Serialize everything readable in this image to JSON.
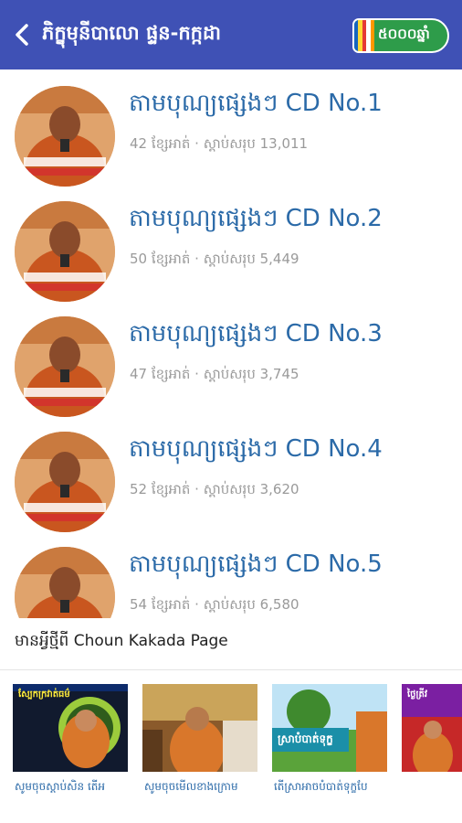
{
  "appbar": {
    "title": "ភិក្ខុមុនីបាលោ ផ្ទន-កក្កដា",
    "logo_text": "៥០០០ឆ្នាំ",
    "flag_colors": [
      "#1565c0",
      "#fdd835",
      "#e53935",
      "#ffffff",
      "#ff9800"
    ]
  },
  "list": {
    "items": [
      {
        "title": "តាមបុណ្យផ្សេងៗ CD No.1",
        "meta": "42 ខ្សែអាត់ · ស្តាប់សរុប 13,011"
      },
      {
        "title": "តាមបុណ្យផ្សេងៗ CD No.2",
        "meta": "50 ខ្សែអាត់ · ស្តាប់សរុប 5,449"
      },
      {
        "title": "តាមបុណ្យផ្សេងៗ CD No.3",
        "meta": "47 ខ្សែអាត់ · ស្តាប់សរុប 3,745"
      },
      {
        "title": "តាមបុណ្យផ្សេងៗ CD No.4",
        "meta": "52 ខ្សែអាត់ · ស្តាប់សរុប 3,620"
      },
      {
        "title": "តាមបុណ្យផ្សេងៗ CD No.5",
        "meta": "54 ខ្សែអាត់ · ស្តាប់សរុប 6,580"
      }
    ]
  },
  "news": {
    "label": "មានអ្វីថ្មីពី Choun Kakada Page",
    "cards": [
      {
        "caption": "សូមចុចស្តាប់សិន តើអ",
        "overlay": "ស្បែកក្រវាត់ធម៌"
      },
      {
        "caption": "សូមចុចមើលខាងក្រោម",
        "overlay": ""
      },
      {
        "caption": "តើស្រាអាចបំបាត់ទុក្ខបែ",
        "overlay": "ស្រាបំបាត់ទុក្ខ"
      },
      {
        "caption": "",
        "overlay": "ថ្ងៃត្រីវ"
      }
    ]
  }
}
